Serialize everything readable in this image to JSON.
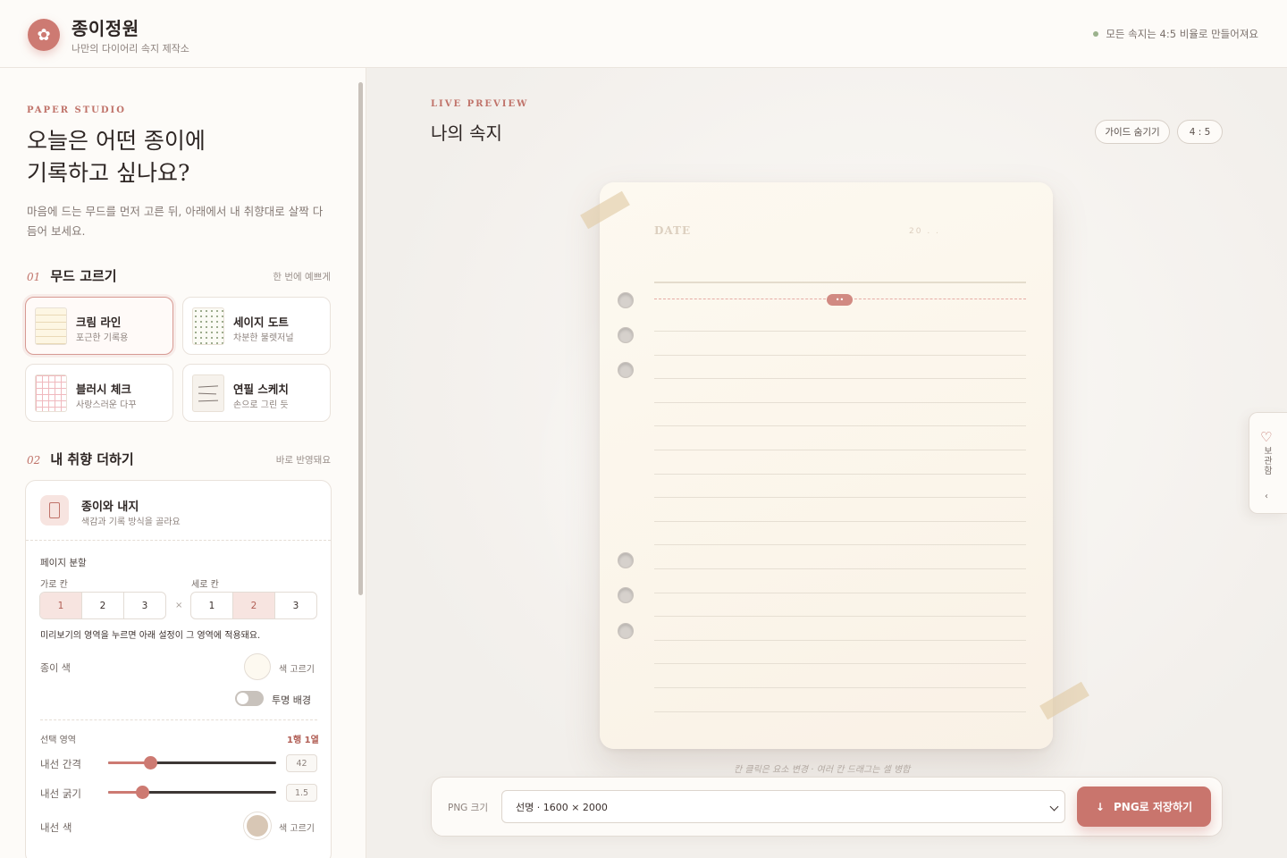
{
  "header": {
    "title": "종이정원",
    "subtitle": "나만의 다이어리 속지 제작소",
    "note": "모든 속지는 4:5 비율로 만들어져요"
  },
  "sidebar": {
    "eyebrow": "PAPER STUDIO",
    "hero_line1": "오늘은 어떤 종이에",
    "hero_line2": "기록하고 싶나요?",
    "hero_sub": "마음에 드는 무드를 먼저 고른 뒤, 아래에서 내 취향대로 살짝 다듬어 보세요.",
    "section1": {
      "num": "01",
      "title": "무드 고르기",
      "hint": "한 번에 예쁘게"
    },
    "moods": [
      {
        "name": "크림 라인",
        "desc": "포근한 기록용",
        "selected": true
      },
      {
        "name": "세이지 도트",
        "desc": "차분한 불렛저널",
        "selected": false
      },
      {
        "name": "블러시 체크",
        "desc": "사랑스러운 다꾸",
        "selected": false
      },
      {
        "name": "연필 스케치",
        "desc": "손으로 그린 듯",
        "selected": false
      }
    ],
    "section2": {
      "num": "02",
      "title": "내 취향 더하기",
      "hint": "바로 반영돼요"
    },
    "panel": {
      "title": "종이와 내지",
      "subtitle": "색감과 기록 방식을 골라요",
      "split_label": "페이지 분할",
      "cols_label": "가로 칸",
      "rows_label": "세로 칸",
      "cols_options": [
        "1",
        "2",
        "3"
      ],
      "cols_selected": "1",
      "rows_options": [
        "1",
        "2",
        "3"
      ],
      "rows_selected": "2",
      "times": "×",
      "help": "미리보기의 영역을 누르면 아래 설정이 그 영역에 적용돼요.",
      "paper_color_label": "종이 색",
      "paper_color": "#fdf9f0",
      "pick_color": "색 고르기",
      "transparent_label": "투명 배경",
      "transparent_on": false,
      "selected_area_label": "선택 영역",
      "selected_area_value": "1행 1열",
      "line_gap_label": "내선 간격",
      "line_gap_value": "42",
      "line_gap_fraction": 0.25,
      "line_width_label": "내선 굵기",
      "line_width_value": "1.5",
      "line_width_fraction": 0.2,
      "line_color_label": "내선 색",
      "line_color": "#d8c7b5"
    }
  },
  "preview": {
    "eyebrow": "LIVE PREVIEW",
    "title": "나의 속지",
    "guide_button": "가이드 숨기기",
    "ratio_button": "4 : 5",
    "paper_date": "DATE",
    "paper_year": "20 . .",
    "selection_tag": "••",
    "hint": "칸 클릭은 요소 변경 · 여러 칸 드래그는 셀 병합"
  },
  "export": {
    "label": "PNG 크기",
    "selected": "선명 · 1600 × 2000",
    "save_label": "PNG로 저장하기"
  },
  "side_tab": {
    "label": "보관함"
  },
  "colors": {
    "accent": "#c9756d",
    "brand": "#cd7a72",
    "status_dot": "#9bb28d"
  }
}
